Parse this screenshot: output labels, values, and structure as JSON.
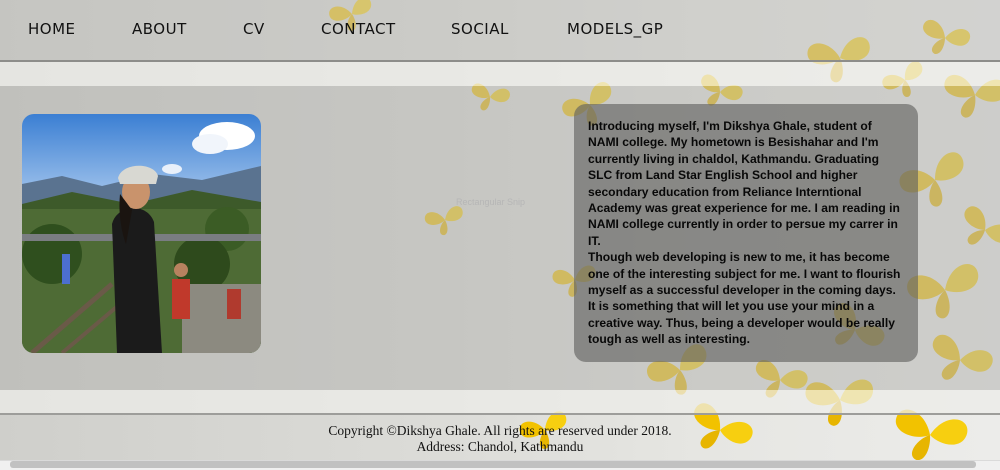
{
  "nav": {
    "items": [
      {
        "label": "HOME"
      },
      {
        "label": "ABOUT"
      },
      {
        "label": "CV"
      },
      {
        "label": "CONTACT"
      },
      {
        "label": "SOCIAL"
      },
      {
        "label": "MODELS_GP"
      }
    ]
  },
  "about": {
    "paragraph1": "Introducing myself, I'm Dikshya Ghale, student of NAMI college. My hometown is Besishahar and I'm currently living in chaldol, Kathmandu. Graduating SLC from Land Star English School and higher secondary education from Reliance Interntional Academy was great experience for me. I am reading in NAMI college currently in order to persue my carrer in IT.",
    "paragraph2": "Though web developing is new to me, it has become one of the interesting subject for me. I want to flourish myself as a successful developer in the coming days. It is something that will let you use your mind in a creative way. Thus, being a developer would be really tough as well as interesting."
  },
  "ghost_tooltip": "Rectangular Snip",
  "footer": {
    "copyright": "Copyright ©Dikshya Ghale. All rights are reserved under 2018.",
    "address": "Address: Chandol, Kathmandu"
  },
  "colors": {
    "butterfly": "#f2c200",
    "intro_box": "#5f5f5d",
    "text": "#111111"
  }
}
